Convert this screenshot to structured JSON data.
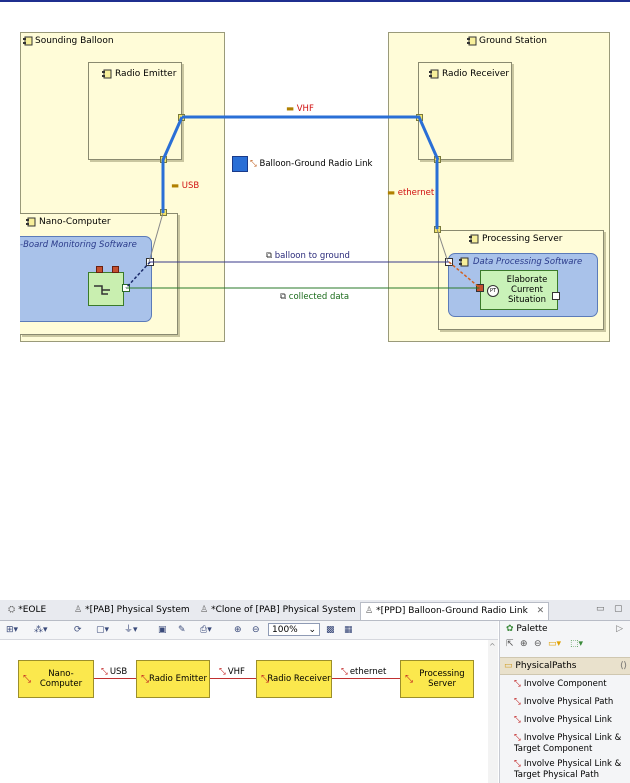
{
  "diagram": {
    "sounding_balloon": "Sounding Balloon",
    "ground_station": "Ground Station",
    "radio_emitter": "Radio Emitter",
    "radio_receiver": "Radio Receiver",
    "nano_computer": "Nano-Computer",
    "onboard_software": "-Board Monitoring Software",
    "processing_server": "Processing Server",
    "data_processing_software": "Data Processing Software",
    "elaborate_function": "Elaborate Current Situation",
    "link_vhf": "VHF",
    "link_usb": "USB",
    "link_ethernet": "ethernet",
    "path_label": "Balloon-Ground Radio Link",
    "exchange_1": "balloon to ground",
    "exchange_2": "collected data",
    "colors": {
      "physical_link": "#2a6fd6",
      "exchange_1": "#3a3a8a",
      "exchange_2": "#2a7a2a",
      "container": "#fffcd8",
      "software": "#a9c2ea"
    }
  },
  "editor": {
    "tabs": [
      {
        "label": "*EOLE",
        "active": false
      },
      {
        "label": "*[PAB] Physical System",
        "active": false
      },
      {
        "label": "*Clone of [PAB] Physical System",
        "active": false
      },
      {
        "label": "*[PPD] Balloon-Ground Radio Link",
        "active": true
      }
    ],
    "zoom": "100%",
    "nodes": [
      "Nano-Computer",
      "Radio Emitter",
      "Radio Receiver",
      "Processing Server"
    ],
    "edges": [
      "USB",
      "VHF",
      "ethernet"
    ]
  },
  "palette": {
    "title": "Palette",
    "section": "PhysicalPaths",
    "items": [
      "Involve Component",
      "Involve Physical Path",
      "Involve Physical Link",
      "Involve Physical Link & Target Component",
      "Involve Physical Link & Target Physical Path"
    ]
  }
}
